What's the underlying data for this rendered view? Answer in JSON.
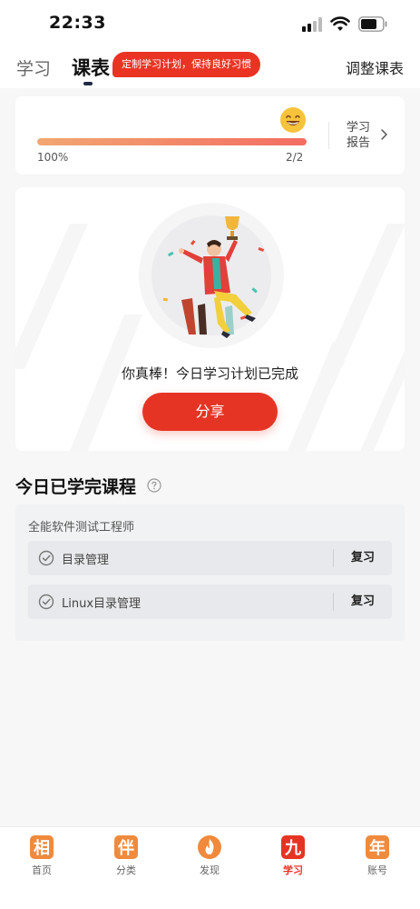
{
  "status_bar": {
    "time": "22:33"
  },
  "header": {
    "tabs": [
      {
        "label": "学习",
        "active": false
      },
      {
        "label": "课表",
        "active": true
      }
    ],
    "tip": "定制学习计划，保持良好习惯",
    "adjust_label": "调整课表"
  },
  "progress": {
    "percent_label": "100%",
    "fraction": 1.0,
    "count_label": "2/2",
    "report_label": "学习报告"
  },
  "completion": {
    "message": "你真棒！今日学习计划已完成",
    "share_label": "分享"
  },
  "today_section": {
    "title": "今日已学完课程",
    "course_name": "全能软件测试工程师",
    "lessons": [
      {
        "title": "目录管理",
        "action": "复习"
      },
      {
        "title": "Linux目录管理",
        "action": "复习"
      }
    ]
  },
  "bottom_nav": {
    "items": [
      {
        "label": "首页",
        "glyph": "相",
        "active": false
      },
      {
        "label": "分类",
        "glyph": "伴",
        "active": false
      },
      {
        "label": "发现",
        "glyph": "",
        "active": false
      },
      {
        "label": "学习",
        "glyph": "九",
        "active": true
      },
      {
        "label": "账号",
        "glyph": "年",
        "active": false
      }
    ]
  },
  "colors": {
    "accent": "#e63424",
    "progress_start": "#f2a772",
    "progress_end": "#f36c62",
    "nav_orange": "#f08a3c"
  }
}
